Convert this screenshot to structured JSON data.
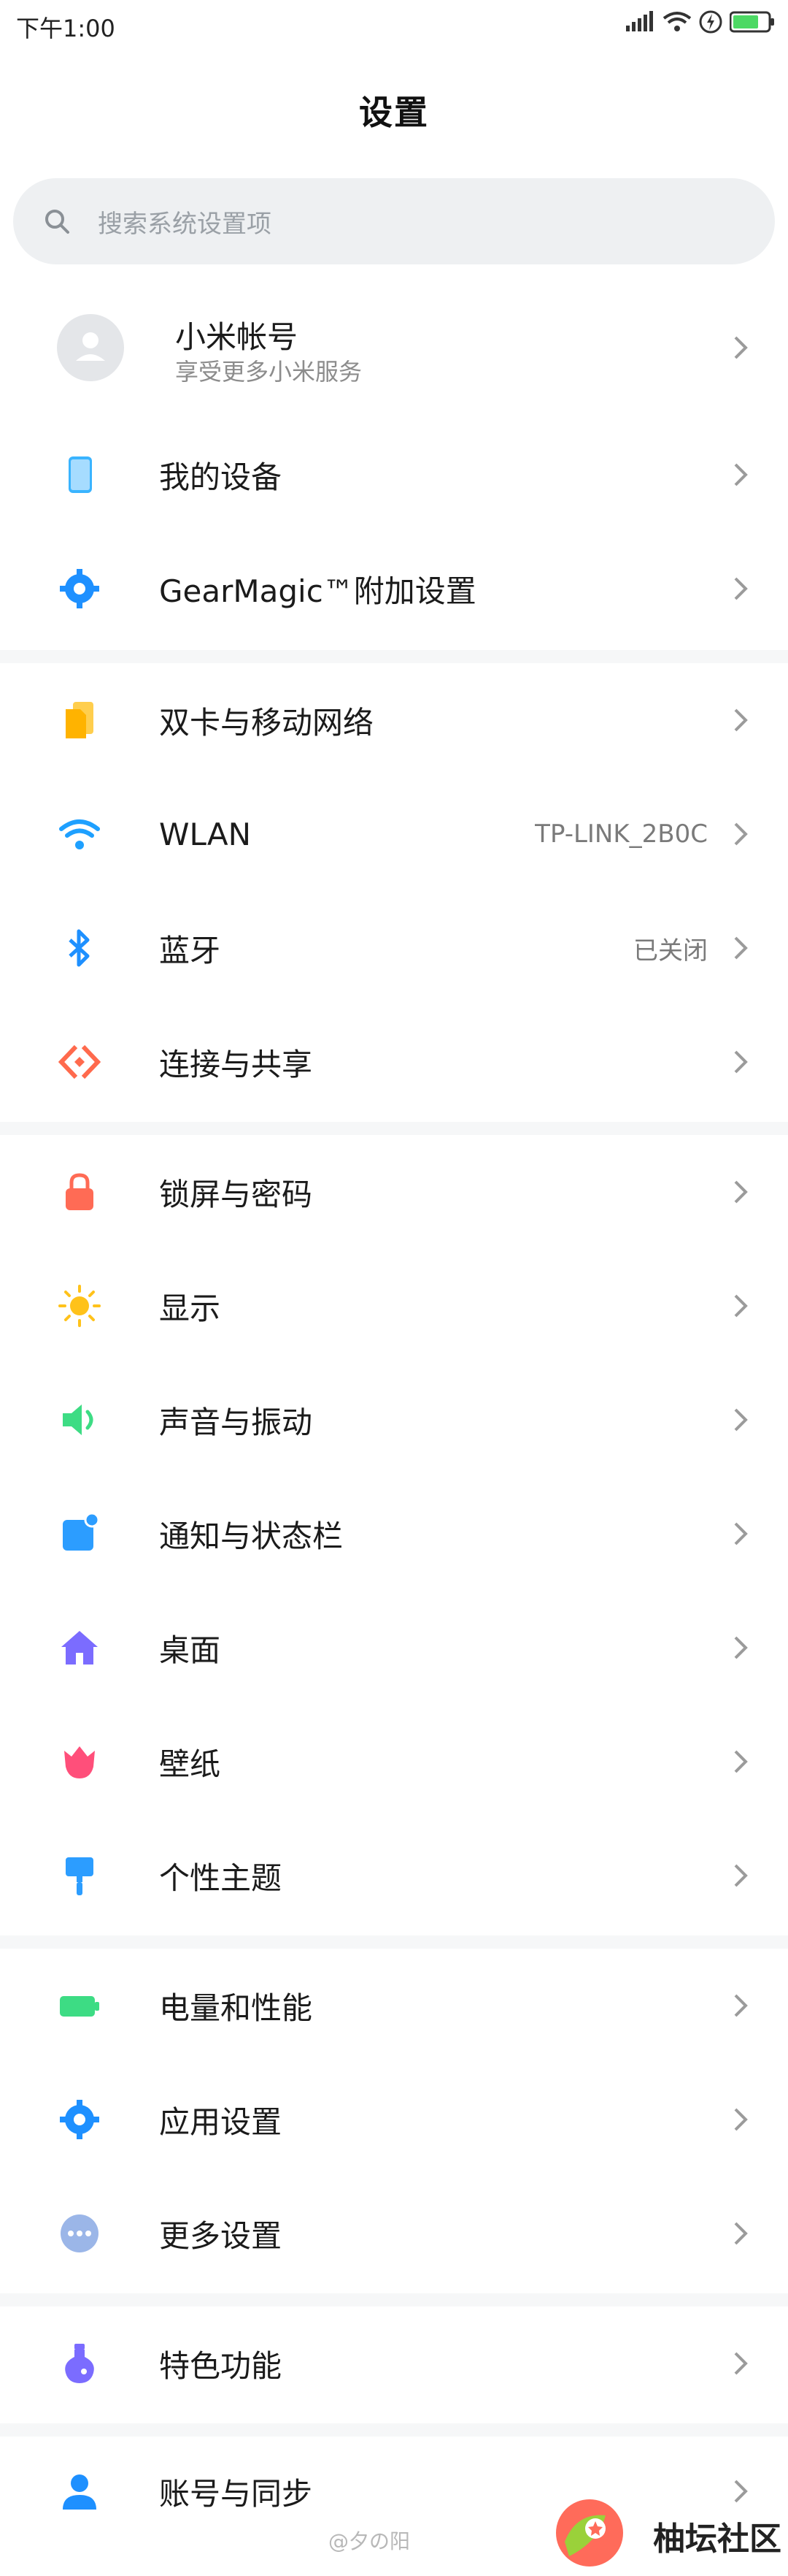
{
  "status": {
    "time": "下午1:00"
  },
  "header": {
    "title": "设置"
  },
  "search": {
    "placeholder": "搜索系统设置项"
  },
  "account": {
    "name": "小米帐号",
    "subtitle": "享受更多小米服务"
  },
  "items": [
    {
      "label": "我的设备",
      "value": ""
    },
    {
      "label": "GearMagic™附加设置",
      "value": ""
    },
    {
      "label": "双卡与移动网络",
      "value": ""
    },
    {
      "label": "WLAN",
      "value": "TP-LINK_2B0C"
    },
    {
      "label": "蓝牙",
      "value": "已关闭"
    },
    {
      "label": "连接与共享",
      "value": ""
    },
    {
      "label": "锁屏与密码",
      "value": ""
    },
    {
      "label": "显示",
      "value": ""
    },
    {
      "label": "声音与振动",
      "value": ""
    },
    {
      "label": "通知与状态栏",
      "value": ""
    },
    {
      "label": "桌面",
      "value": ""
    },
    {
      "label": "壁纸",
      "value": ""
    },
    {
      "label": "个性主题",
      "value": ""
    },
    {
      "label": "电量和性能",
      "value": ""
    },
    {
      "label": "应用设置",
      "value": ""
    },
    {
      "label": "更多设置",
      "value": ""
    },
    {
      "label": "特色功能",
      "value": ""
    },
    {
      "label": "账号与同步",
      "value": ""
    }
  ],
  "watermark": "@夕の阳",
  "brand": "柚坛社区"
}
